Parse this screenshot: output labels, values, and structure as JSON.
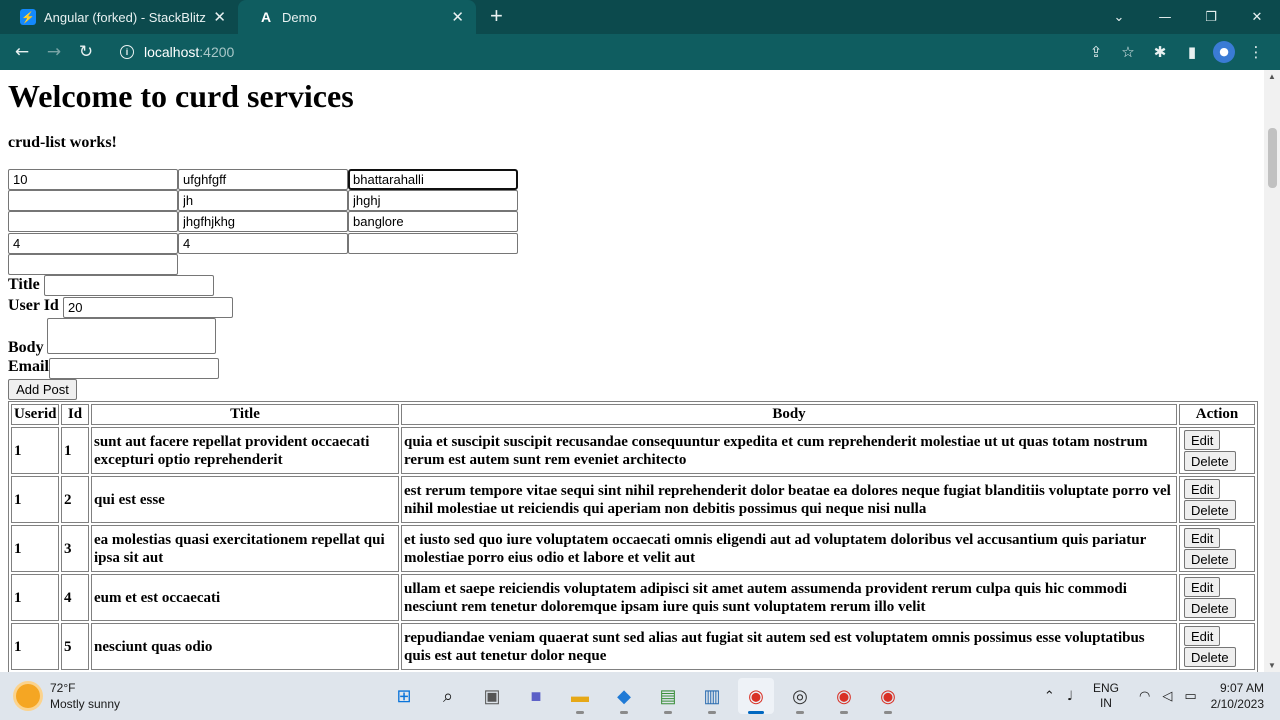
{
  "browser": {
    "tabs": [
      {
        "label": "Angular (forked) - StackBlitz",
        "icon": "stackblitz-icon",
        "active": false
      },
      {
        "label": "Demo",
        "icon": "angular-icon",
        "active": true
      }
    ],
    "new_tab": "+",
    "address": {
      "host": "localhost",
      "port": ":4200"
    }
  },
  "page": {
    "title": "Welcome to curd services",
    "subtitle": "crud-list works!",
    "grid_inputs": [
      [
        "10",
        "ufghfgff",
        "bhattarahalli"
      ],
      [
        "",
        "jh",
        "jhghj"
      ],
      [
        "",
        "jhgfhjkhg",
        "banglore"
      ],
      [
        "4",
        "4",
        ""
      ],
      [
        ""
      ]
    ],
    "form": {
      "title_label": "Title",
      "title_value": "",
      "userid_label": "User Id",
      "userid_value": "20",
      "body_label": "Body",
      "body_value": "",
      "email_label": "Email",
      "email_value": "",
      "add_button": "Add Post"
    },
    "table": {
      "headers": [
        "Userid",
        "Id",
        "Title",
        "Body",
        "Action"
      ],
      "edit_label": "Edit",
      "delete_label": "Delete",
      "rows": [
        {
          "userid": "1",
          "id": "1",
          "title": "sunt aut facere repellat provident occaecati excepturi optio reprehenderit",
          "body": "quia et suscipit suscipit recusandae consequuntur expedita et cum reprehenderit molestiae ut ut quas totam nostrum rerum est autem sunt rem eveniet architecto"
        },
        {
          "userid": "1",
          "id": "2",
          "title": "qui est esse",
          "body": "est rerum tempore vitae sequi sint nihil reprehenderit dolor beatae ea dolores neque fugiat blanditiis voluptate porro vel nihil molestiae ut reiciendis qui aperiam non debitis possimus qui neque nisi nulla"
        },
        {
          "userid": "1",
          "id": "3",
          "title": "ea molestias quasi exercitationem repellat qui ipsa sit aut",
          "body": "et iusto sed quo iure voluptatem occaecati omnis eligendi aut ad voluptatem doloribus vel accusantium quis pariatur molestiae porro eius odio et labore et velit aut"
        },
        {
          "userid": "1",
          "id": "4",
          "title": "eum et est occaecati",
          "body": "ullam et saepe reiciendis voluptatem adipisci sit amet autem assumenda provident rerum culpa quis hic commodi nesciunt rem tenetur doloremque ipsam iure quis sunt voluptatem rerum illo velit"
        },
        {
          "userid": "1",
          "id": "5",
          "title": "nesciunt quas odio",
          "body": "repudiandae veniam quaerat sunt sed alias aut fugiat sit autem sed est voluptatem omnis possimus esse voluptatibus quis est aut tenetur dolor neque"
        }
      ]
    }
  },
  "taskbar": {
    "weather_temp": "72°F",
    "weather_desc": "Mostly sunny",
    "lang_top": "ENG",
    "lang_bottom": "IN",
    "time": "9:07 AM",
    "date": "2/10/2023"
  },
  "colors": {
    "tabbar": "#0c4a4d",
    "toolbar": "#0f5d60",
    "taskbar": "#dfe5ec"
  }
}
